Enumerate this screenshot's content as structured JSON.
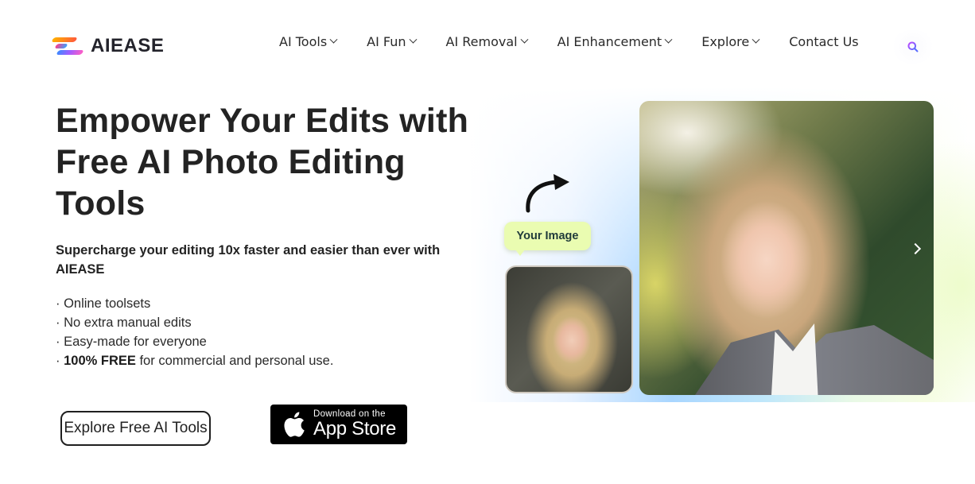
{
  "header": {
    "logo_text": "AIEASE",
    "nav": [
      {
        "label": "AI Tools",
        "has_dropdown": true
      },
      {
        "label": "AI Fun",
        "has_dropdown": true
      },
      {
        "label": "AI Removal",
        "has_dropdown": true
      },
      {
        "label": "AI Enhancement",
        "has_dropdown": true
      },
      {
        "label": "Explore",
        "has_dropdown": true
      },
      {
        "label": "Contact Us",
        "has_dropdown": false
      }
    ],
    "search_icon": "search-icon"
  },
  "hero": {
    "title": "Empower Your Edits with Free AI Photo Editing Tools",
    "subtitle": "Supercharge your editing 10x faster and easier than ever with AIEASE",
    "features": [
      {
        "prefix": "· ",
        "bold": "",
        "text": "Online toolsets"
      },
      {
        "prefix": "· ",
        "bold": "",
        "text": "No extra manual edits"
      },
      {
        "prefix": "· ",
        "bold": "",
        "text": "Easy-made for everyone"
      },
      {
        "prefix": "· ",
        "bold": "100% FREE",
        "text": " for commercial and personal use."
      }
    ],
    "explore_button": "Explore Free AI Tools",
    "app_store": {
      "small": "Download on the",
      "big": "App Store"
    }
  },
  "showcase": {
    "bubble_label": "Your Image",
    "input_photo": "casual selfie portrait",
    "output_photo": "professional headshot portrait",
    "next_icon": "chevron-right-icon"
  },
  "colors": {
    "text": "#232323",
    "bubble_bg": "#eafcb1",
    "search_gradient_start": "#5b6cff",
    "search_gradient_end": "#c04bff"
  }
}
